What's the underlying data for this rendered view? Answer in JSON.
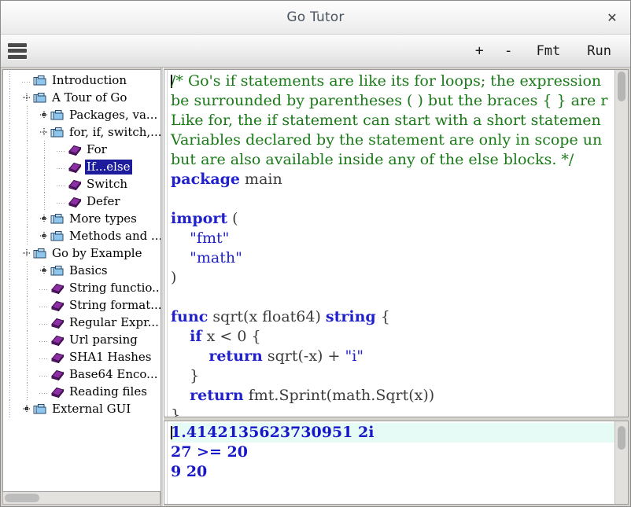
{
  "window": {
    "title": "Go Tutor",
    "close_label": "✕"
  },
  "toolbar": {
    "menu_icon": "hamburger-menu-icon",
    "buttons": [
      {
        "label": "+",
        "name": "zoom-in-button"
      },
      {
        "label": "-",
        "name": "zoom-out-button"
      },
      {
        "label": "Fmt",
        "name": "format-button"
      },
      {
        "label": "Run",
        "name": "run-button"
      }
    ]
  },
  "tree": {
    "items": [
      {
        "label": "Introduction",
        "depth": 0,
        "icon": "folder-icon",
        "toggle": "stub",
        "selected": false
      },
      {
        "label": "A Tour of Go",
        "depth": 0,
        "icon": "folder-icon",
        "toggle": "open",
        "selected": false
      },
      {
        "label": "Packages,  va...",
        "depth": 1,
        "icon": "folder-icon",
        "toggle": "closed",
        "selected": false
      },
      {
        "label": "for, if, switch,...",
        "depth": 1,
        "icon": "folder-icon",
        "toggle": "open",
        "selected": false
      },
      {
        "label": "For",
        "depth": 2,
        "icon": "book-icon",
        "toggle": "stub",
        "selected": false
      },
      {
        "label": "If...else",
        "depth": 2,
        "icon": "book-icon",
        "toggle": "stub",
        "selected": true
      },
      {
        "label": "Switch",
        "depth": 2,
        "icon": "book-icon",
        "toggle": "stub",
        "selected": false
      },
      {
        "label": "Defer",
        "depth": 2,
        "icon": "book-icon",
        "toggle": "stub",
        "selected": false
      },
      {
        "label": "More types",
        "depth": 1,
        "icon": "folder-icon",
        "toggle": "closed",
        "selected": false
      },
      {
        "label": "Methods and ...",
        "depth": 1,
        "icon": "folder-icon",
        "toggle": "closed",
        "selected": false
      },
      {
        "label": "Go by Example",
        "depth": 0,
        "icon": "folder-icon",
        "toggle": "open",
        "selected": false
      },
      {
        "label": "Basics",
        "depth": 1,
        "icon": "folder-icon",
        "toggle": "closed",
        "selected": false
      },
      {
        "label": "String functio...",
        "depth": 1,
        "icon": "book-icon",
        "toggle": "stub",
        "selected": false
      },
      {
        "label": "String format...",
        "depth": 1,
        "icon": "book-icon",
        "toggle": "stub",
        "selected": false
      },
      {
        "label": "Regular  Expr...",
        "depth": 1,
        "icon": "book-icon",
        "toggle": "stub",
        "selected": false
      },
      {
        "label": "Url parsing",
        "depth": 1,
        "icon": "book-icon",
        "toggle": "stub",
        "selected": false
      },
      {
        "label": "SHA1 Hashes",
        "depth": 1,
        "icon": "book-icon",
        "toggle": "stub",
        "selected": false
      },
      {
        "label": "Base64  Enco...",
        "depth": 1,
        "icon": "book-icon",
        "toggle": "stub",
        "selected": false
      },
      {
        "label": "Reading files",
        "depth": 1,
        "icon": "book-icon",
        "toggle": "stub",
        "selected": false
      },
      {
        "label": "External GUI",
        "depth": 0,
        "icon": "folder-icon",
        "toggle": "closed",
        "selected": false
      }
    ]
  },
  "editor": {
    "lines": [
      [
        {
          "t": "/* Go's if statements are like its for loops; the expression",
          "c": "c-comment"
        }
      ],
      [
        {
          "t": "be surrounded by parentheses ( ) but the braces { } are r",
          "c": "c-comment"
        }
      ],
      [
        {
          "t": "Like for, the if statement can start with a short statemen",
          "c": "c-comment"
        }
      ],
      [
        {
          "t": "Variables declared by the statement are only in scope un",
          "c": "c-comment"
        }
      ],
      [
        {
          "t": "but are also available inside any of the else blocks. */",
          "c": "c-comment"
        }
      ],
      [
        {
          "t": "package",
          "c": "c-kw"
        },
        {
          "t": " main",
          "c": "c-plain"
        }
      ],
      [
        {
          "t": "",
          "c": "c-plain"
        }
      ],
      [
        {
          "t": "import",
          "c": "c-kw"
        },
        {
          "t": " (",
          "c": "c-plain"
        }
      ],
      [
        {
          "t": "    ",
          "c": "c-plain"
        },
        {
          "t": "\"fmt\"",
          "c": "c-str"
        }
      ],
      [
        {
          "t": "    ",
          "c": "c-plain"
        },
        {
          "t": "\"math\"",
          "c": "c-str"
        }
      ],
      [
        {
          "t": ")",
          "c": "c-plain"
        }
      ],
      [
        {
          "t": "",
          "c": "c-plain"
        }
      ],
      [
        {
          "t": "func",
          "c": "c-kw"
        },
        {
          "t": " sqrt(x float64) ",
          "c": "c-plain"
        },
        {
          "t": "string",
          "c": "c-kw"
        },
        {
          "t": " {",
          "c": "c-plain"
        }
      ],
      [
        {
          "t": "    ",
          "c": "c-plain"
        },
        {
          "t": "if",
          "c": "c-kw"
        },
        {
          "t": " x < 0 {",
          "c": "c-plain"
        }
      ],
      [
        {
          "t": "        ",
          "c": "c-plain"
        },
        {
          "t": "return",
          "c": "c-kw"
        },
        {
          "t": " sqrt(-x) + ",
          "c": "c-plain"
        },
        {
          "t": "\"i\"",
          "c": "c-str"
        }
      ],
      [
        {
          "t": "    }",
          "c": "c-plain"
        }
      ],
      [
        {
          "t": "    ",
          "c": "c-plain"
        },
        {
          "t": "return",
          "c": "c-kw"
        },
        {
          "t": " fmt.Sprint(math.Sqrt(x))",
          "c": "c-plain"
        }
      ],
      [
        {
          "t": "}",
          "c": "c-plain"
        }
      ]
    ]
  },
  "output": {
    "lines": [
      "1.4142135623730951 2i",
      "27 >= 20",
      "9 20"
    ]
  },
  "colors": {
    "comment": "#1a7a18",
    "keyword": "#2222cc",
    "string": "#2222cc",
    "output_text": "#1818c8",
    "selection_bg": "#1c1c9c",
    "cursor_line_bg": "#e6fbf6",
    "folder_icon": "#7fb8e6",
    "book_icon": "#7b2d8e"
  }
}
